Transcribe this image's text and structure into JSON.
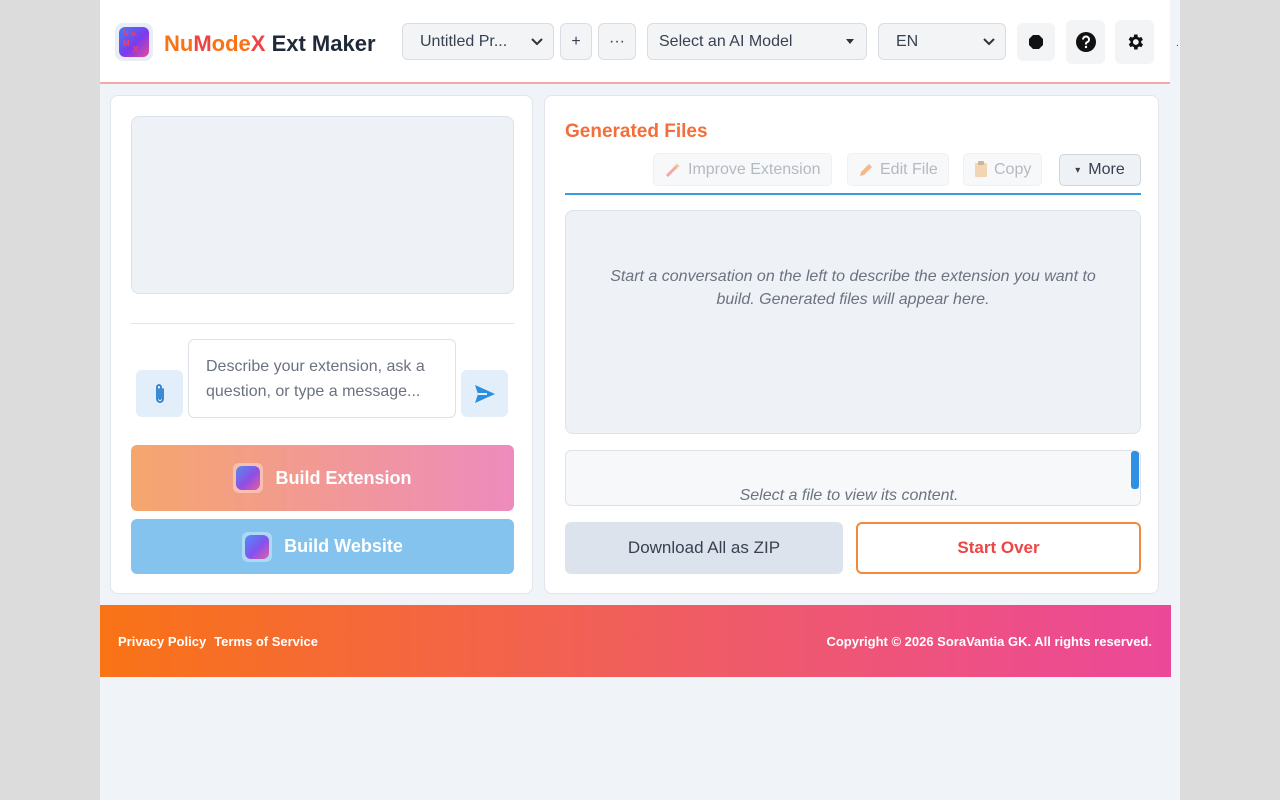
{
  "header": {
    "brand": {
      "nu": "Nu",
      "m": "M",
      "ode": "ode",
      "x": "X",
      "rest": " Ext Maker"
    },
    "logo_letters": [
      "N",
      "u",
      "M",
      "X"
    ],
    "project_select": "Untitled Pr...",
    "add_button": "+",
    "more_button": "···",
    "model_select": "Select an AI Model",
    "language_select": "EN",
    "icons": [
      "octagon-icon",
      "help-icon",
      "gear-icon"
    ],
    "trunc_dot": "."
  },
  "left": {
    "message_placeholder": "Describe your extension, ask a question, or type a message...",
    "build_extension": "Build Extension",
    "build_website": "Build Website"
  },
  "right": {
    "title": "Generated Files",
    "toolbar": {
      "improve": "Improve Extension",
      "edit": "Edit File",
      "copy": "Copy",
      "more": "More",
      "more_arrow": "▾"
    },
    "empty_text": "Start a conversation on the left to describe the extension you want to build. Generated files will appear here.",
    "viewer_text": "Select a file to view its content.",
    "download_zip": "Download All as ZIP",
    "start_over": "Start Over"
  },
  "footer": {
    "privacy": "Privacy Policy",
    "terms": "Terms of Service",
    "copyright": "Copyright © 2026 SoraVantia GK. All rights reserved."
  },
  "colors": {
    "accent_orange": "#f97316",
    "accent_pink": "#ec4899",
    "accent_blue": "#3b9be0"
  }
}
